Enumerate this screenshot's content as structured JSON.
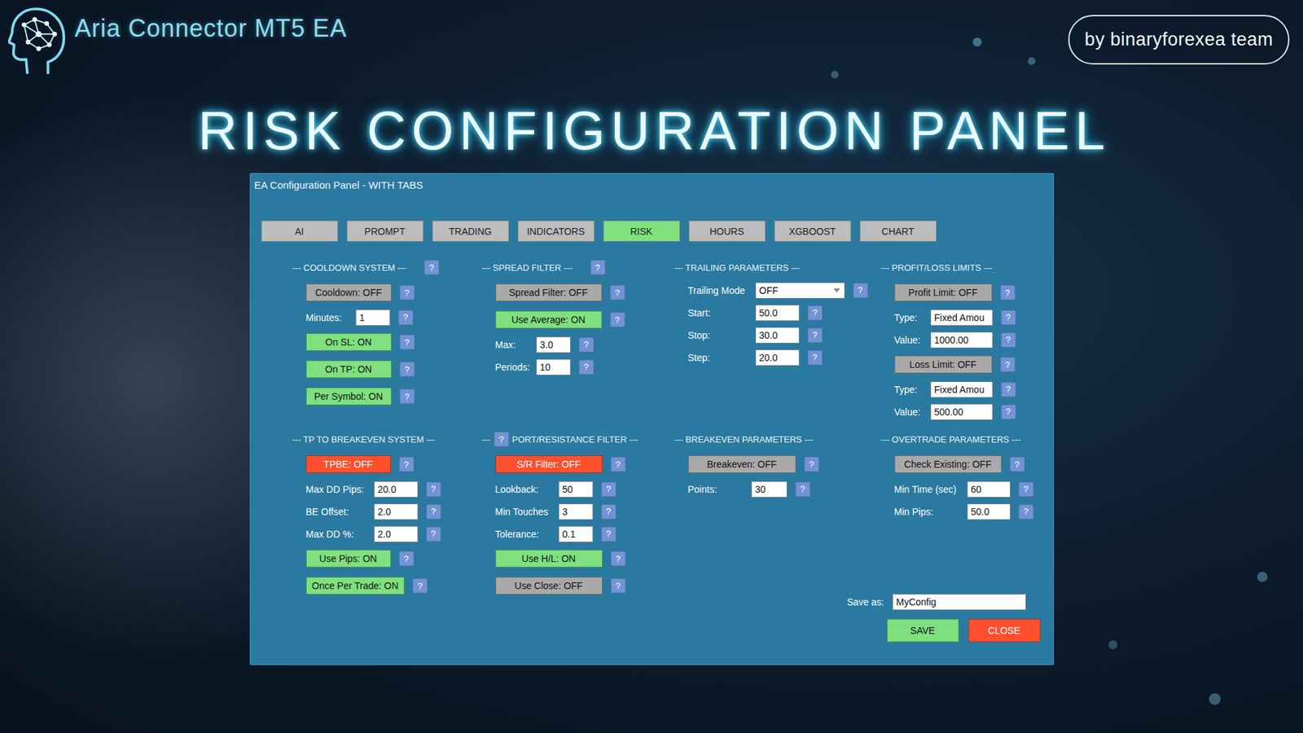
{
  "header": {
    "brand": "Aria Connector MT5 EA",
    "credit": "by binaryforexea team",
    "headline": "RISK CONFIGURATION PANEL"
  },
  "window": {
    "title": "EA Configuration Panel - WITH TABS"
  },
  "tabs": [
    {
      "label": "AI",
      "selected": false
    },
    {
      "label": "PROMPT",
      "selected": false
    },
    {
      "label": "TRADING",
      "selected": false
    },
    {
      "label": "INDICATORS",
      "selected": false
    },
    {
      "label": "RISK",
      "selected": true
    },
    {
      "label": "HOURS",
      "selected": false
    },
    {
      "label": "XGBOOST",
      "selected": false
    },
    {
      "label": "CHART",
      "selected": false
    }
  ],
  "help_label": "?",
  "sections": [
    {
      "header": "--- COOLDOWN SYSTEM ---",
      "header_help": true,
      "rows": [
        {
          "kind": "toggle",
          "label": "Cooldown: OFF",
          "on": false,
          "color": "#a9a9a9"
        },
        {
          "kind": "field",
          "label": "Minutes:",
          "value": "1"
        },
        {
          "kind": "toggle",
          "label": "On SL: ON",
          "on": true,
          "color": "#7fe07f"
        },
        {
          "kind": "toggle",
          "label": "On TP: ON",
          "on": true,
          "color": "#7fe07f"
        },
        {
          "kind": "toggle",
          "label": "Per Symbol: ON",
          "on": true,
          "color": "#7fe07f"
        }
      ]
    },
    {
      "header": "--- SPREAD FILTER ---",
      "header_help": true,
      "rows": [
        {
          "kind": "toggle",
          "label": "Spread Filter: OFF",
          "on": false,
          "color": "#a9a9a9"
        },
        {
          "kind": "toggle",
          "label": "Use Average: ON",
          "on": true,
          "color": "#7fe07f"
        },
        {
          "kind": "field",
          "label": "Max:",
          "value": "3.0"
        },
        {
          "kind": "field",
          "label": "Periods:",
          "value": "10"
        }
      ]
    },
    {
      "header": "--- TRAILING PARAMETERS ---",
      "header_help": false,
      "rows": [
        {
          "kind": "select",
          "label": "Trailing Mode",
          "value": "OFF"
        },
        {
          "kind": "field",
          "label": "Start:",
          "value": "50.0"
        },
        {
          "kind": "field",
          "label": "Stop:",
          "value": "30.0"
        },
        {
          "kind": "field",
          "label": "Step:",
          "value": "20.0"
        }
      ]
    },
    {
      "header": "--- PROFIT/LOSS LIMITS ---",
      "header_help": false,
      "rows": [
        {
          "kind": "toggle",
          "label": "Profit Limit: OFF",
          "on": false,
          "color": "#a9a9a9"
        },
        {
          "kind": "field",
          "label": "Type:",
          "value": "Fixed Amou"
        },
        {
          "kind": "field",
          "label": "Value:",
          "value": "1000.00"
        },
        {
          "kind": "toggle",
          "label": "Loss Limit: OFF",
          "on": false,
          "color": "#a9a9a9"
        },
        {
          "kind": "field",
          "label": "Type:",
          "value": "Fixed Amou"
        },
        {
          "kind": "field",
          "label": "Value:",
          "value": "500.00"
        }
      ]
    },
    {
      "header": "--- TP TO BREAKEVEN SYSTEM ---",
      "header_help": false,
      "rows": [
        {
          "kind": "toggle",
          "label": "TPBE: OFF",
          "on": false,
          "color": "#ff4f2e"
        },
        {
          "kind": "field",
          "label": "Max DD Pips:",
          "value": "20.0"
        },
        {
          "kind": "field",
          "label": "BE Offset:",
          "value": "2.0"
        },
        {
          "kind": "field",
          "label": "Max DD %:",
          "value": "2.0"
        },
        {
          "kind": "toggle",
          "label": "Use Pips: ON",
          "on": true,
          "color": "#7fe07f"
        },
        {
          "kind": "toggle",
          "label": "Once Per Trade: ON",
          "on": true,
          "color": "#7fe07f"
        }
      ]
    },
    {
      "header_lead": "---",
      "header": "PORT/RESISTANCE FILTER ---",
      "header_help": true,
      "rows": [
        {
          "kind": "toggle",
          "label": "S/R Filter: OFF",
          "on": false,
          "color": "#ff4f2e"
        },
        {
          "kind": "field",
          "label": "Lookback:",
          "value": "50"
        },
        {
          "kind": "field",
          "label": "Min Touches",
          "value": "3"
        },
        {
          "kind": "field",
          "label": "Tolerance:",
          "value": "0.1"
        },
        {
          "kind": "toggle",
          "label": "Use H/L: ON",
          "on": true,
          "color": "#7fe07f"
        },
        {
          "kind": "toggle",
          "label": "Use Close: OFF",
          "on": false,
          "color": "#a9a9a9"
        }
      ]
    },
    {
      "header": "--- BREAKEVEN PARAMETERS ---",
      "header_help": false,
      "rows": [
        {
          "kind": "toggle",
          "label": "Breakeven: OFF",
          "on": false,
          "color": "#a9a9a9"
        },
        {
          "kind": "field",
          "label": "Points:",
          "value": "30"
        }
      ]
    },
    {
      "header": "--- OVERTRADE PARAMETERS ---",
      "header_help": false,
      "rows": [
        {
          "kind": "toggle",
          "label": "Check Existing: OFF",
          "on": false,
          "color": "#a9a9a9"
        },
        {
          "kind": "field",
          "label": "Min Time (sec)",
          "value": "60"
        },
        {
          "kind": "field",
          "label": "Min Pips:",
          "value": "50.0"
        }
      ]
    }
  ],
  "save": {
    "label": "Save as:",
    "value": "MyConfig"
  },
  "buttons": [
    {
      "label": "SAVE",
      "color": "#7fe07f"
    },
    {
      "label": "CLOSE",
      "color": "#ff4f2e"
    }
  ]
}
